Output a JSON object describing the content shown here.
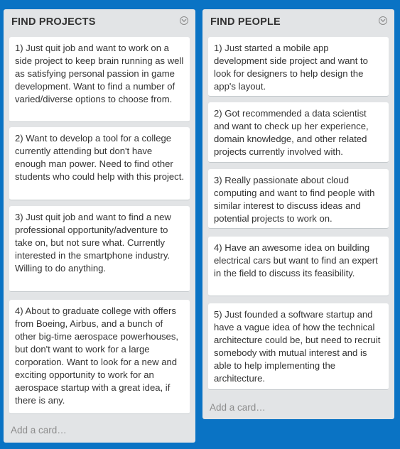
{
  "lists": [
    {
      "title": "FIND PROJECTS",
      "cards": [
        "1) Just quit job and want to work on a side project to keep brain running as well as satisfying personal passion in game development. Want to find a number of varied/diverse options to choose from.",
        "2) Want to develop a tool for a college currently attending but don't have enough man power. Need to find other students who could help with this project.",
        "3) Just quit job and want to find a new professional opportunity/adventure to take on, but not sure what. Currently interested in the smartphone industry. Willing to do anything.",
        "4) About to graduate college with offers from Boeing, Airbus, and a bunch of other big-time aerospace powerhouses, but don't want to work for a large corporation. Want to look for a new and exciting opportunity to work for an aerospace startup with a great idea, if there is any."
      ],
      "add_card": "Add a card…"
    },
    {
      "title": "FIND PEOPLE",
      "cards": [
        "1) Just started a mobile app development side project and want to look for designers to help design the app's layout.",
        "2) Got recommended a data scientist and want to check up her experience, domain knowledge, and other related projects currently involved with.",
        "3) Really passionate about cloud computing and want to find people with similar interest to discuss ideas and potential projects to work on.",
        "4) Have an awesome idea on building electrical cars but want to find an expert in the field to discuss its feasibility.",
        "5) Just founded a software startup and have a vague idea of how the technical architecture could be, but need to recruit somebody with mutual interest and is able to help implementing the architecture."
      ],
      "add_card": "Add a card…"
    }
  ],
  "icons": {
    "list_menu": "chevron-down-circle-icon"
  },
  "colors": {
    "board_background": "#0a73c4",
    "list_background": "#e2e4e6",
    "card_background": "#ffffff",
    "text": "#333333",
    "muted_text": "#8c8c8c"
  }
}
